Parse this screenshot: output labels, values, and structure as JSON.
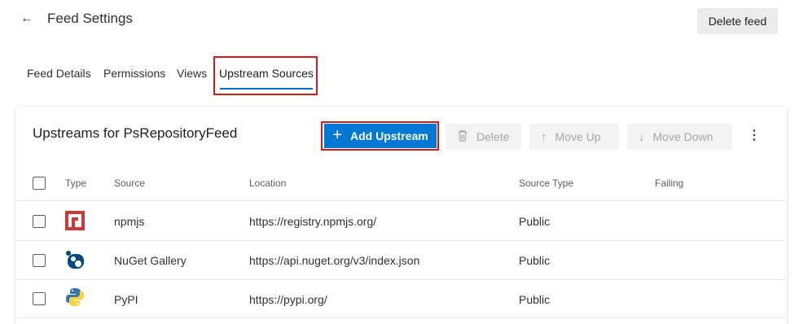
{
  "header": {
    "title": "Feed Settings",
    "delete_feed_label": "Delete feed"
  },
  "tabs": [
    {
      "label": "Feed Details"
    },
    {
      "label": "Permissions"
    },
    {
      "label": "Views"
    },
    {
      "label": "Upstream Sources"
    }
  ],
  "active_tab": "Upstream Sources",
  "card": {
    "title": "Upstreams for PsRepositoryFeed",
    "toolbar": {
      "add_label": "Add Upstream",
      "delete_label": "Delete",
      "move_up_label": "Move Up",
      "move_down_label": "Move Down"
    }
  },
  "table": {
    "columns": [
      "Type",
      "Source",
      "Location",
      "Source Type",
      "Failing"
    ],
    "rows": [
      {
        "type_icon": "npm-icon",
        "source": "npmjs",
        "location": "https://registry.npmjs.org/",
        "source_type": "Public",
        "failing": ""
      },
      {
        "type_icon": "nuget-icon",
        "source": "NuGet Gallery",
        "location": "https://api.nuget.org/v3/index.json",
        "source_type": "Public",
        "failing": ""
      },
      {
        "type_icon": "python-icon",
        "source": "PyPI",
        "location": "https://pypi.org/",
        "source_type": "Public",
        "failing": ""
      }
    ]
  },
  "colors": {
    "accent": "#0078d4",
    "highlight": "#d11a1a",
    "npm_red": "#cb3837",
    "nuget_navy": "#004880",
    "python_blue": "#3776ab",
    "python_yellow": "#ffd43b"
  }
}
